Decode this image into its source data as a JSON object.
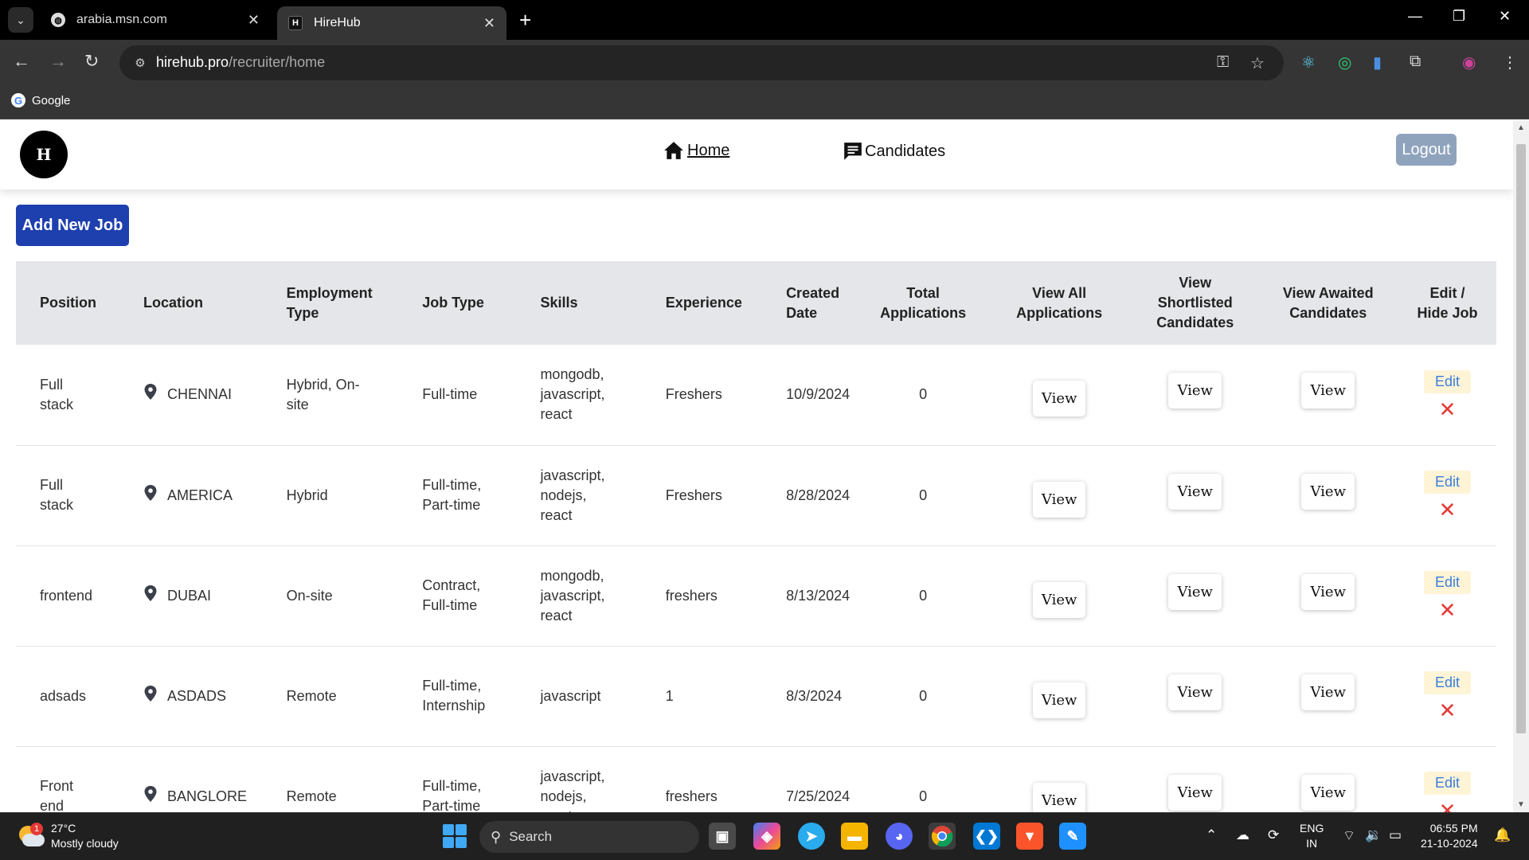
{
  "browser": {
    "tabs": [
      {
        "title": "arabia.msn.com",
        "active": false
      },
      {
        "title": "HireHub",
        "active": true
      }
    ],
    "url_domain": "hirehub.pro",
    "url_path": "/recruiter/home",
    "bookmark": "Google"
  },
  "nav": {
    "logo_text": "H",
    "home_label": "Home",
    "candidates_label": "Candidates",
    "logout_label": "Logout"
  },
  "actions": {
    "add_job_label": "Add New Job"
  },
  "table": {
    "headers": {
      "position": "Position",
      "location": "Location",
      "employment_type": "Employment Type",
      "job_type": "Job Type",
      "skills": "Skills",
      "experience": "Experience",
      "created_date": "Created Date",
      "total_applications": "Total Applications",
      "view_all": "View All Applications",
      "view_shortlisted": "View Shortlisted Candidates",
      "view_awaited": "View Awaited Candidates",
      "edit_hide": "Edit / Hide Job"
    },
    "view_label": "View",
    "edit_label": "Edit",
    "rows": [
      {
        "position": "Full stack",
        "location": "CHENNAI",
        "employment_type": "Hybrid, On-site",
        "job_type": "Full-time",
        "skills": "mongodb, javascript, react",
        "experience": "Freshers",
        "created_date": "10/9/2024",
        "total_applications": "0"
      },
      {
        "position": "Full stack",
        "location": "AMERICA",
        "employment_type": "Hybrid",
        "job_type": "Full-time, Part-time",
        "skills": "javascript, nodejs, react",
        "experience": "Freshers",
        "created_date": "8/28/2024",
        "total_applications": "0"
      },
      {
        "position": "frontend",
        "location": "DUBAI",
        "employment_type": "On-site",
        "job_type": "Contract, Full-time",
        "skills": "mongodb, javascript, react",
        "experience": "freshers",
        "created_date": "8/13/2024",
        "total_applications": "0"
      },
      {
        "position": "adsads",
        "location": "ASDADS",
        "employment_type": "Remote",
        "job_type": "Full-time, Internship",
        "skills": "javascript",
        "experience": "1",
        "created_date": "8/3/2024",
        "total_applications": "0"
      },
      {
        "position": "Front end",
        "location": "BANGLORE",
        "employment_type": "Remote",
        "job_type": "Full-time, Part-time",
        "skills": "javascript, nodejs, react",
        "experience": "freshers",
        "created_date": "7/25/2024",
        "total_applications": "0"
      }
    ]
  },
  "taskbar": {
    "weather_temp": "27°C",
    "weather_desc": "Mostly cloudy",
    "weather_badge": "1",
    "search_label": "Search",
    "lang_top": "ENG",
    "lang_bottom": "IN",
    "time": "06:55 PM",
    "date": "21-10-2024"
  }
}
